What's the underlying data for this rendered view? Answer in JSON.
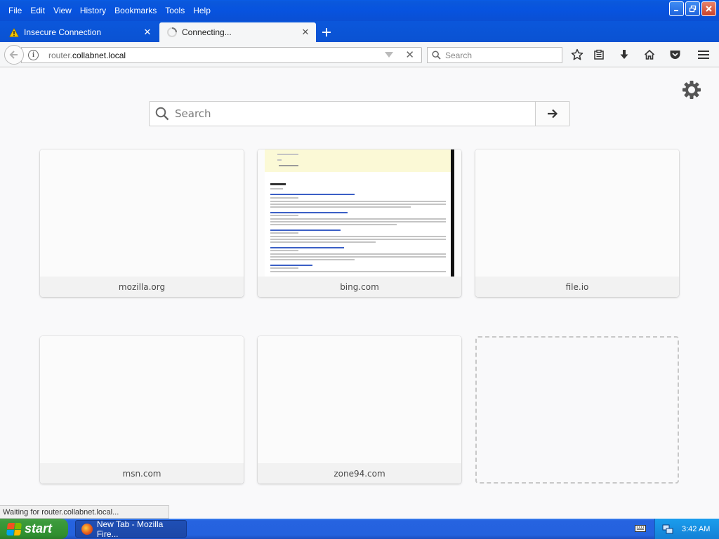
{
  "menubar": {
    "items": [
      {
        "label": "File"
      },
      {
        "label": "Edit"
      },
      {
        "label": "View"
      },
      {
        "label": "History"
      },
      {
        "label": "Bookmarks"
      },
      {
        "label": "Tools"
      },
      {
        "label": "Help"
      }
    ]
  },
  "tabs": [
    {
      "label": "Insecure Connection",
      "icon": "warning-icon",
      "active": false
    },
    {
      "label": "Connecting...",
      "icon": "loading-spinner-icon",
      "active": true
    }
  ],
  "navbar": {
    "url_prefix": "router.",
    "url_domain": "collabnet.local",
    "search_placeholder": "Search"
  },
  "newtab": {
    "search_placeholder": "Search",
    "tiles": [
      {
        "caption": "mozilla.org"
      },
      {
        "caption": "bing.com",
        "thumbnail": "bing-results-page"
      },
      {
        "caption": "file.io"
      },
      {
        "caption": "msn.com"
      },
      {
        "caption": "zone94.com"
      }
    ],
    "empty_slot": true
  },
  "statusbar": {
    "text": "Waiting for router.collabnet.local..."
  },
  "taskbar": {
    "start_label": "start",
    "task_label": "New Tab - Mozilla Fire...",
    "clock": "3:42 AM"
  },
  "colors": {
    "xp_blue": "#0a53d6",
    "start_green": "#3c9a3c",
    "tray_blue": "#1590e0",
    "warning_yellow": "#f5c400"
  }
}
